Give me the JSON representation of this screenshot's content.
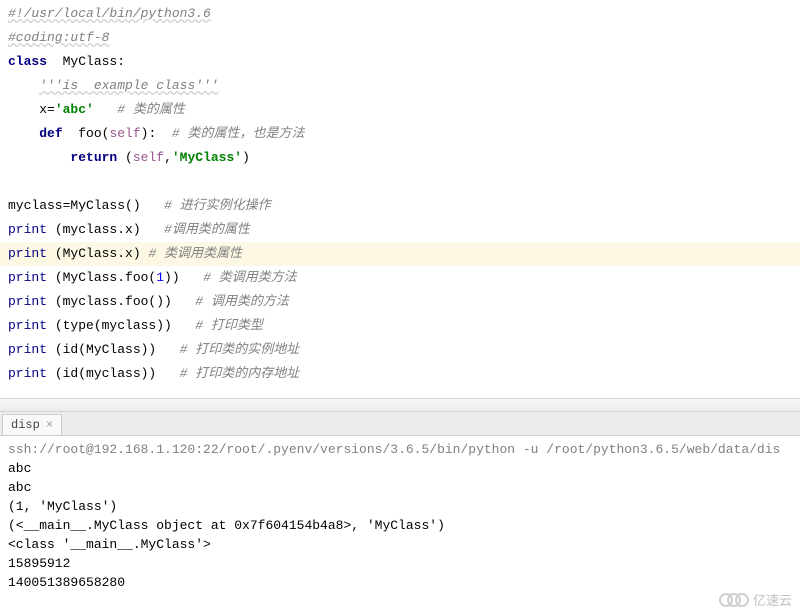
{
  "code": {
    "l1": "#!/usr/local/bin/python3.6",
    "l2": "#coding:utf-8",
    "l3_kw": "class",
    "l3_name": "MyClass",
    "l3_colon": ":",
    "l4_doc": "'''is  example class'''",
    "l5_x": "x=",
    "l5_str": "'abc'",
    "l5_cmt": "# 类的属性",
    "l6_def": "def",
    "l6_name": "foo",
    "l6_op": "(",
    "l6_self": "self",
    "l6_cp": "):",
    "l6_cmt": "# 类的属性，也是方法",
    "l7_ret": "return",
    "l7_op": " (",
    "l7_self": "self",
    "l7_comma": ",",
    "l7_str": "'MyClass'",
    "l7_cp": ")",
    "l9": "myclass=MyClass()",
    "l9_cmt": "# 进行实例化操作",
    "l10_pre": "print",
    "l10_arg": " (myclass.x)",
    "l10_cmt": "#调用类的属性",
    "l11_pre": "print",
    "l11_arg": " (MyClass.x)",
    "l11_cmt": "# 类调用类属性",
    "l12_pre": "print",
    "l12_arg1": " (MyClass.foo(",
    "l12_num": "1",
    "l12_arg2": "))",
    "l12_cmt": "# 类调用类方法",
    "l13_pre": "print",
    "l13_arg": " (myclass.foo())",
    "l13_cmt": "# 调用类的方法",
    "l14_pre": "print",
    "l14_arg": " (type(myclass))",
    "l14_cmt": "# 打印类型",
    "l15_pre": "print",
    "l15_arg": " (id(MyClass))",
    "l15_cmt": "# 打印类的实例地址",
    "l16_pre": "print",
    "l16_arg": " (id(myclass))",
    "l16_cmt": "# 打印类的内存地址"
  },
  "tab": {
    "name": "disp"
  },
  "console": {
    "ssh": "ssh://root@192.168.1.120:22/root/.pyenv/versions/3.6.5/bin/python -u /root/python3.6.5/web/data/dis",
    "o1": "abc",
    "o2": "abc",
    "o3": "(1, 'MyClass')",
    "o4": "(<__main__.MyClass object at 0x7f604154b4a8>, 'MyClass')",
    "o5": "<class '__main__.MyClass'>",
    "o6": "15895912",
    "o7": "140051389658280"
  },
  "watermark": {
    "text": "亿速云"
  }
}
